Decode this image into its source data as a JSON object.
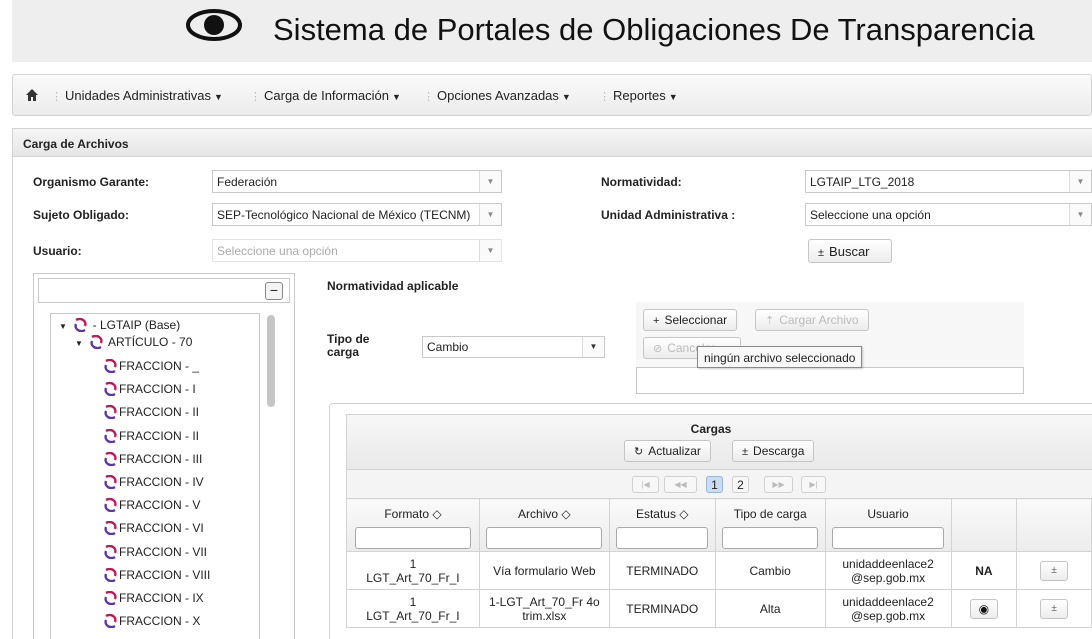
{
  "header": {
    "title": "Sistema de Portales de Obligaciones De Transparencia",
    "logo_icon": "eye-icon"
  },
  "navbar": {
    "home_icon": "home-icon",
    "items": [
      {
        "label": "Unidades Administrativas"
      },
      {
        "label": "Carga de Información"
      },
      {
        "label": "Opciones Avanzadas"
      },
      {
        "label": "Reportes"
      }
    ]
  },
  "panel": {
    "title": "Carga de Archivos"
  },
  "form": {
    "organismo_label": "Organismo Garante:",
    "organismo_value": "Federación",
    "sujeto_label": "Sujeto Obligado:",
    "sujeto_value": "SEP-Tecnológico Nacional de México (TECNM)",
    "usuario_label": "Usuario:",
    "usuario_value": "Seleccione una opción",
    "normatividad_label": "Normatividad:",
    "normatividad_value": "LGTAIP_LTG_2018",
    "unidad_label": "Unidad Administrativa :",
    "unidad_value": "Seleccione una opción",
    "buscar_label": "Buscar"
  },
  "tree": {
    "root": "- LGTAIP (Base)",
    "article": "ARTÍCULO - 70",
    "fracciones": [
      "FRACCION - _",
      "FRACCION - I",
      "FRACCION - II",
      "FRACCION - II",
      "FRACCION - III",
      "FRACCION - IV",
      "FRACCION - V",
      "FRACCION - VI",
      "FRACCION - VII",
      "FRACCION - VIII",
      "FRACCION - IX",
      "FRACCION - X"
    ]
  },
  "upload": {
    "normatividad_aplicable": "Normatividad aplicable",
    "tipo_label": "Tipo de carga",
    "tipo_value": "Cambio",
    "seleccionar": "Seleccionar",
    "cargar": "Cargar Archivo",
    "cancelar": "Cancelar",
    "tooltip": "ningún archivo seleccionado"
  },
  "cargas": {
    "title": "Cargas",
    "actualizar": "Actualizar",
    "descarga": "Descarga",
    "pages": [
      "1",
      "2"
    ],
    "current_page": "1",
    "columns": [
      "Formato ◇",
      "Archivo ◇",
      "Estatus ◇",
      "Tipo de carga",
      "Usuario"
    ],
    "rows": [
      {
        "formato_num": "1",
        "formato": "LGT_Art_70_Fr_I",
        "archivo": "Vía formulario Web",
        "estatus": "TERMINADO",
        "tipo": "Cambio",
        "usuario_1": "unidaddeenlace2",
        "usuario_2": "@sep.gob.mx",
        "accion": "NA"
      },
      {
        "formato_num": "1",
        "formato": "LGT_Art_70_Fr_I",
        "archivo": "1-LGT_Art_70_Fr 4o trim.xlsx",
        "estatus": "TERMINADO",
        "tipo": "Alta",
        "usuario_1": "unidaddeenlace2",
        "usuario_2": "@sep.gob.mx",
        "accion": "view-icon"
      }
    ]
  },
  "colors": {
    "tree_icon": "#c2185b",
    "tree_icon_alt": "#5e35b1",
    "active_page": "#c9dcf2"
  }
}
